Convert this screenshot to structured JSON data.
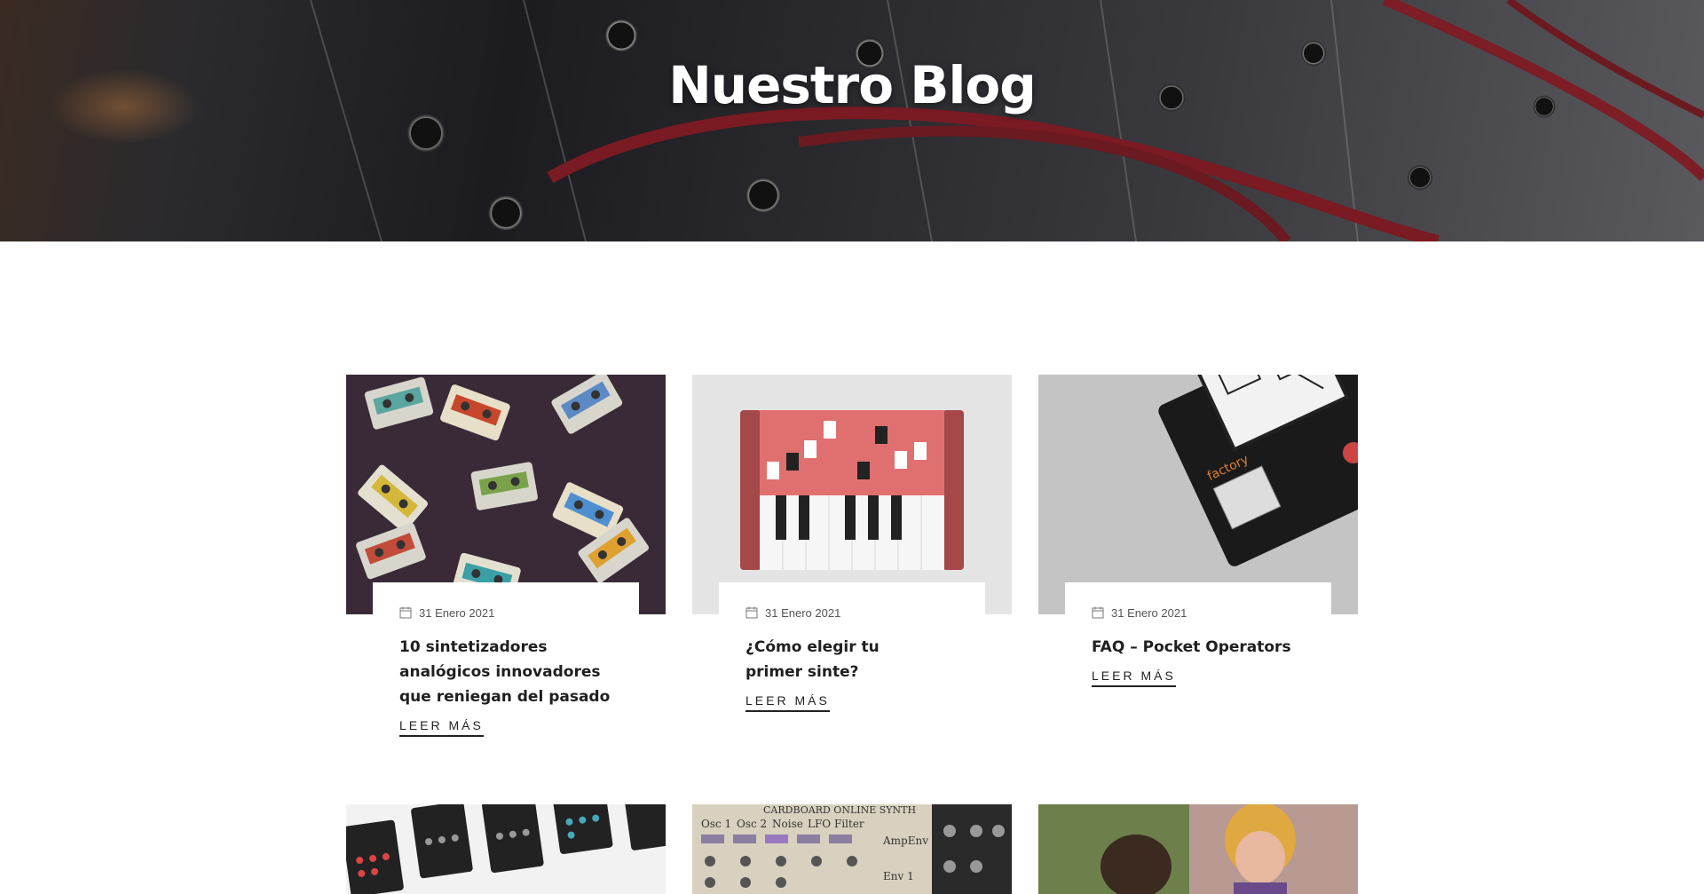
{
  "hero": {
    "title": "Nuestro Blog"
  },
  "posts": [
    {
      "date": "31 Enero 2021",
      "title": "10 sintetizadores analógicos innovadores que reniegan del pasado",
      "read_more": "LEER MÁS",
      "image": "cassette-tapes"
    },
    {
      "date": "31 Enero 2021",
      "title": "¿Cómo elegir tu primer sinte?",
      "read_more": "LEER MÁS",
      "image": "synthesizer-illustration"
    },
    {
      "date": "31 Enero 2021",
      "title": "FAQ – Pocket Operators",
      "read_more": "LEER MÁS",
      "image": "pocket-operator-board"
    },
    {
      "image": "pocket-operators-grid"
    },
    {
      "image": "cardboard-online-synth",
      "image_text": {
        "header": "CARDBOARD ONLINE SYNTH",
        "labels": [
          "Osc 1",
          "Osc 2",
          "Noise",
          "LFO",
          "Filter",
          "AmpEnv",
          "Env 1"
        ]
      }
    },
    {
      "image": "vintage-photo"
    }
  ],
  "icons": {
    "date": "calendar-icon"
  },
  "colors": {
    "accent_text": "#222222",
    "hero_title": "#ffffff",
    "synth_red": "#e07070"
  }
}
